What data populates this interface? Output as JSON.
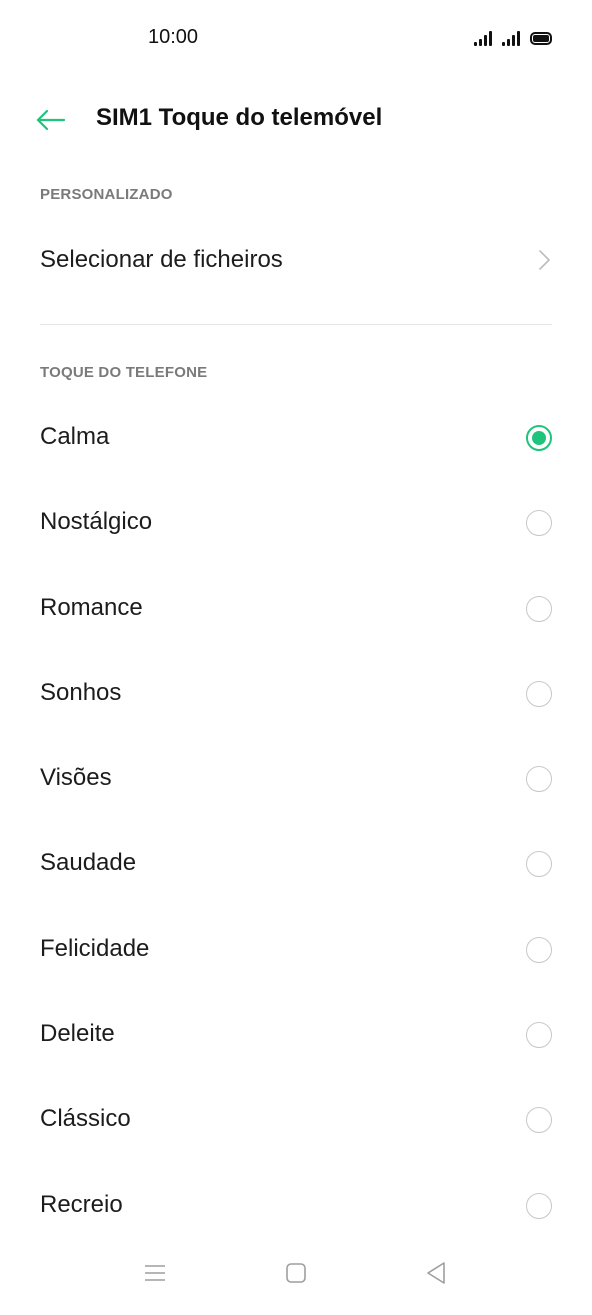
{
  "status_bar": {
    "time": "10:00"
  },
  "header": {
    "title": "SIM1 Toque do telemóvel",
    "back_icon": "arrow-left-icon"
  },
  "custom_section": {
    "header": "PERSONALIZADO",
    "select_files_label": "Selecionar de ficheiros"
  },
  "ringtone_section": {
    "header": "TOQUE DO TELEFONE",
    "items": [
      {
        "label": "Calma",
        "selected": true
      },
      {
        "label": "Nostálgico",
        "selected": false
      },
      {
        "label": "Romance",
        "selected": false
      },
      {
        "label": "Sonhos",
        "selected": false
      },
      {
        "label": "Visões",
        "selected": false
      },
      {
        "label": "Saudade",
        "selected": false
      },
      {
        "label": "Felicidade",
        "selected": false
      },
      {
        "label": "Deleite",
        "selected": false
      },
      {
        "label": "Clássico",
        "selected": false
      },
      {
        "label": "Recreio",
        "selected": false
      }
    ]
  },
  "colors": {
    "accent": "#1fc47c",
    "section_header": "#7a7a7a",
    "radio_unselected": "#c8c8c8"
  }
}
